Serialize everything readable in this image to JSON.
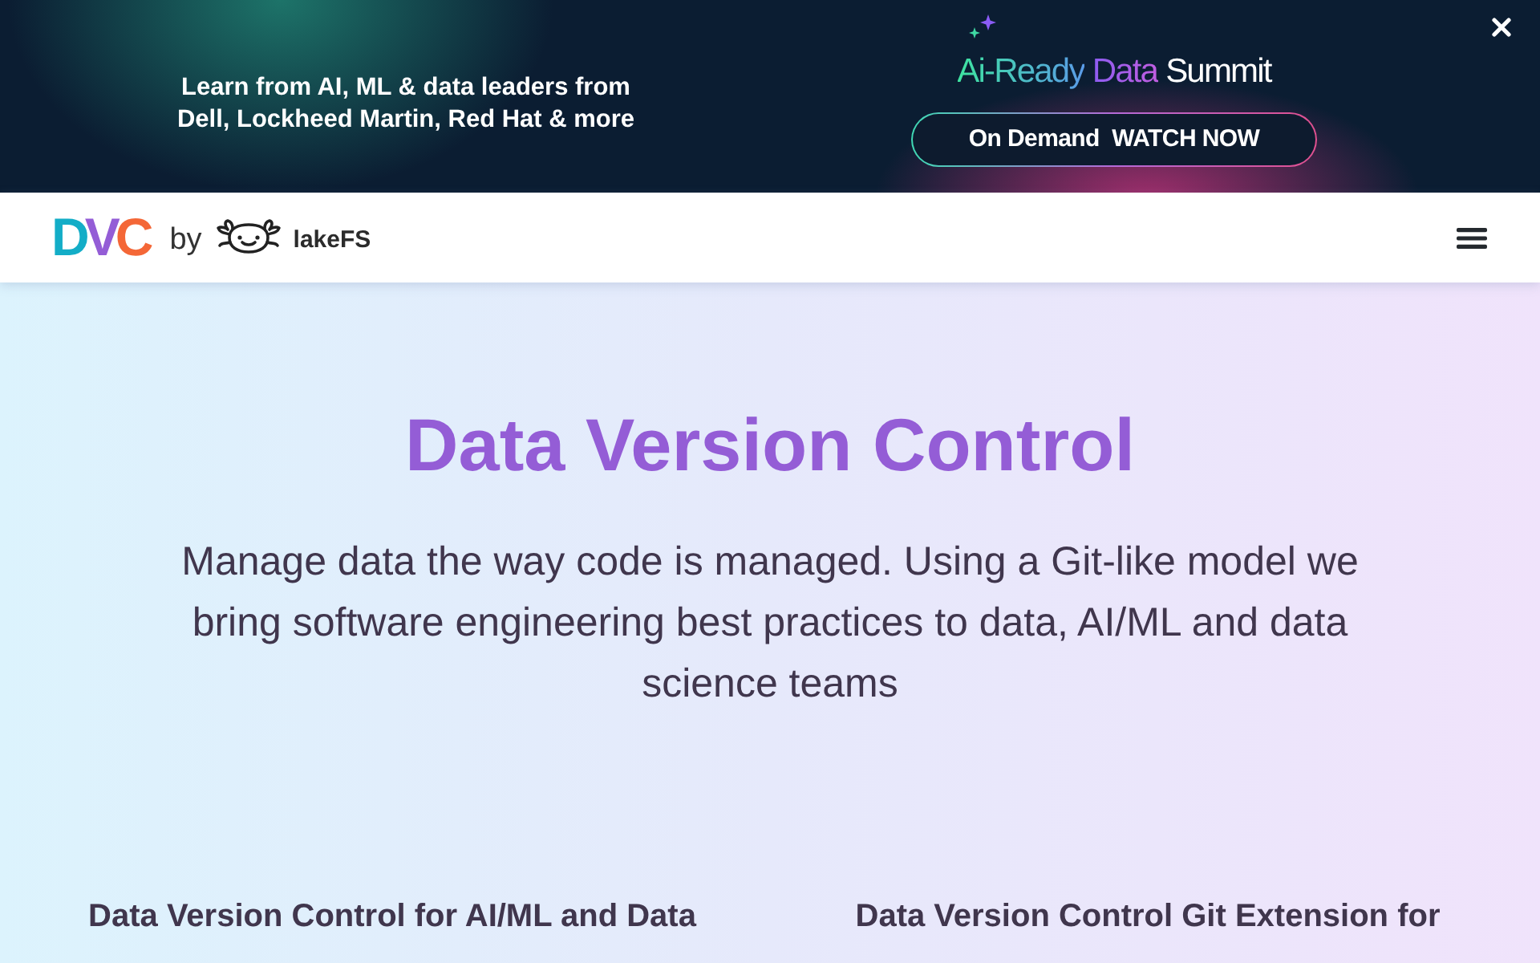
{
  "promo_banner": {
    "text": "Learn from AI, ML & data leaders from Dell, Lockheed Martin, Red Hat & more",
    "event_logo": "Ai-Ready Data Summit",
    "button": "On Demand  WATCH NOW"
  },
  "nav": {
    "logo": "DVC",
    "by": "by",
    "partner": "lakeFS"
  },
  "hero": {
    "title": "Data Version Control",
    "subtitle": "Manage data the way code is managed. Using a Git-like model we bring software engineering best practices to data, AI/ML and data science teams"
  },
  "sections": [
    {
      "heading": "Data Version Control for AI/ML and Data"
    },
    {
      "heading": "Data Version Control Git Extension for"
    }
  ]
}
